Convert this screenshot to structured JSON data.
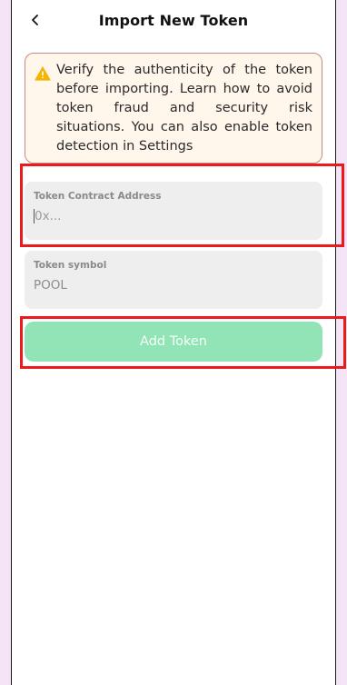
{
  "header": {
    "title": "Import New Token",
    "back_icon": "chevron-left-icon"
  },
  "warning": {
    "icon": "warning-triangle-icon",
    "text": "Verify the authenticity of the token before importing. Learn how to avoid token fraud and security risk situations. You can also enable token detection in Settings",
    "accent_color": "#f5b400",
    "border_color": "#c9897f",
    "background_color": "#fff6ec"
  },
  "fields": {
    "contract_address": {
      "label": "Token Contract Address",
      "placeholder": "0x...",
      "value": ""
    },
    "token_symbol": {
      "label": "Token symbol",
      "value": "POOL"
    }
  },
  "actions": {
    "add_token_label": "Add Token",
    "add_token_color": "#92e3b5"
  },
  "highlight_color": "#ec1a1a"
}
